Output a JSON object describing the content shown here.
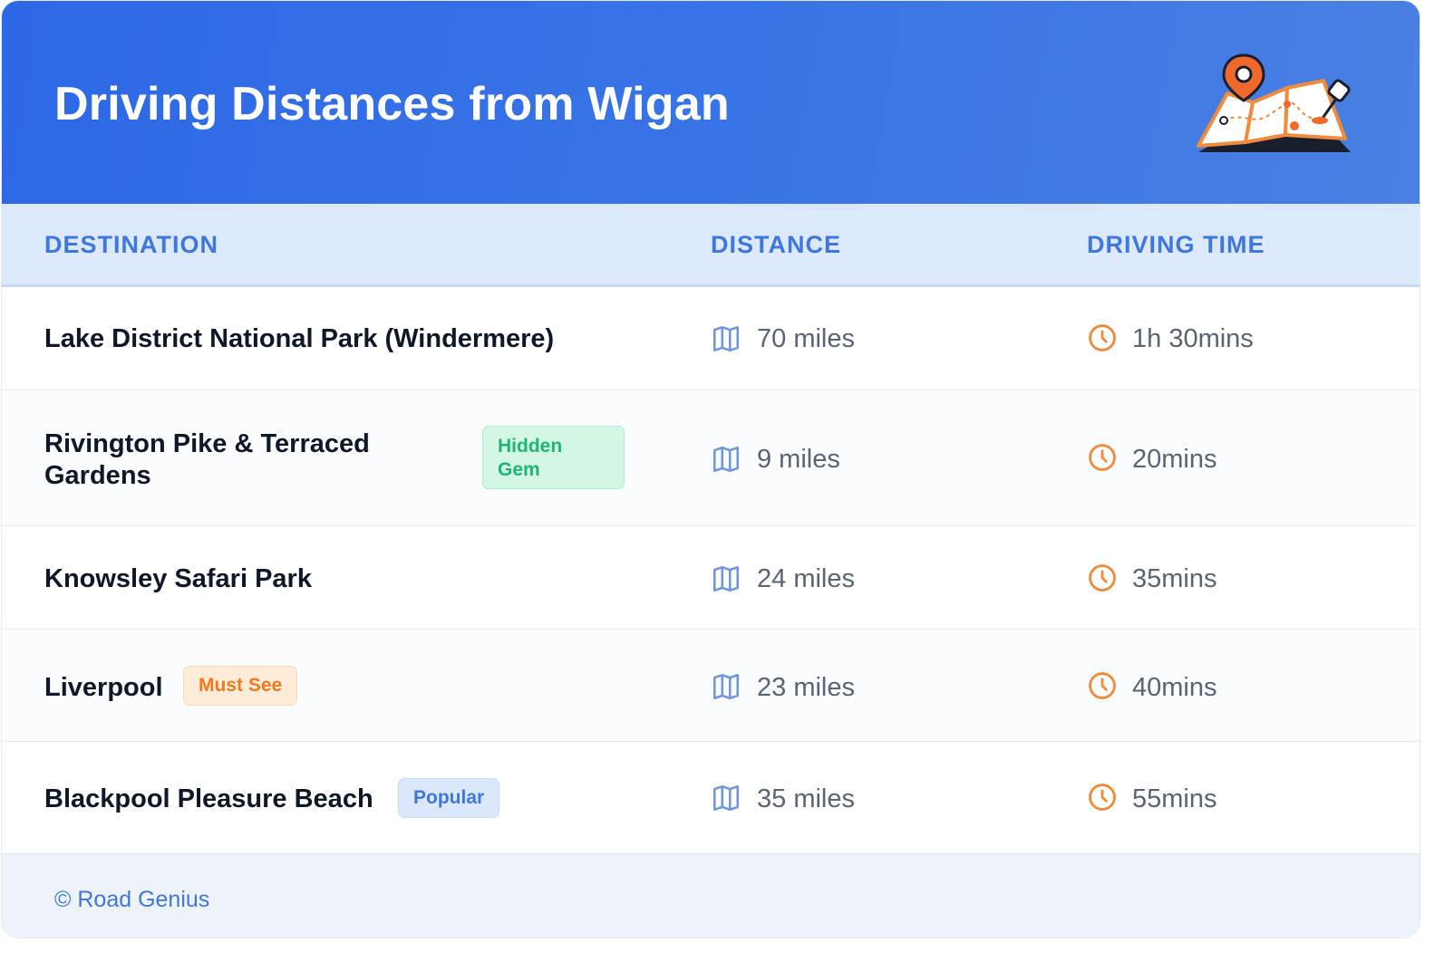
{
  "header": {
    "title": "Driving Distances from Wigan"
  },
  "columns": {
    "destination": "DESTINATION",
    "distance": "DISTANCE",
    "driving_time": "DRIVING TIME"
  },
  "rows": [
    {
      "destination": "Lake District National Park (Windermere)",
      "badge": "",
      "distance": "70 miles",
      "time": "1h 30mins"
    },
    {
      "destination": "Rivington Pike & Terraced Gardens",
      "badge": "Hidden Gem",
      "distance": "9 miles",
      "time": "20mins"
    },
    {
      "destination": "Knowsley Safari Park",
      "badge": "",
      "distance": "24 miles",
      "time": "35mins"
    },
    {
      "destination": "Liverpool",
      "badge": "Must See",
      "distance": "23 miles",
      "time": "40mins"
    },
    {
      "destination": "Blackpool Pleasure Beach",
      "badge": "Popular",
      "distance": "35 miles",
      "time": "55mins"
    }
  ],
  "footer": {
    "credit": "© Road Genius"
  },
  "icons": {
    "distance": "map-icon",
    "time": "clock-icon",
    "header": "map-pin-illustration"
  },
  "colors": {
    "header_gradient_start": "#2d68e6",
    "header_gradient_end": "#4a80e2",
    "accent_blue": "#3f78dc",
    "icon_orange": "#f08a3c",
    "badge_green_text": "#1eb672",
    "badge_orange_text": "#f17a1d"
  }
}
